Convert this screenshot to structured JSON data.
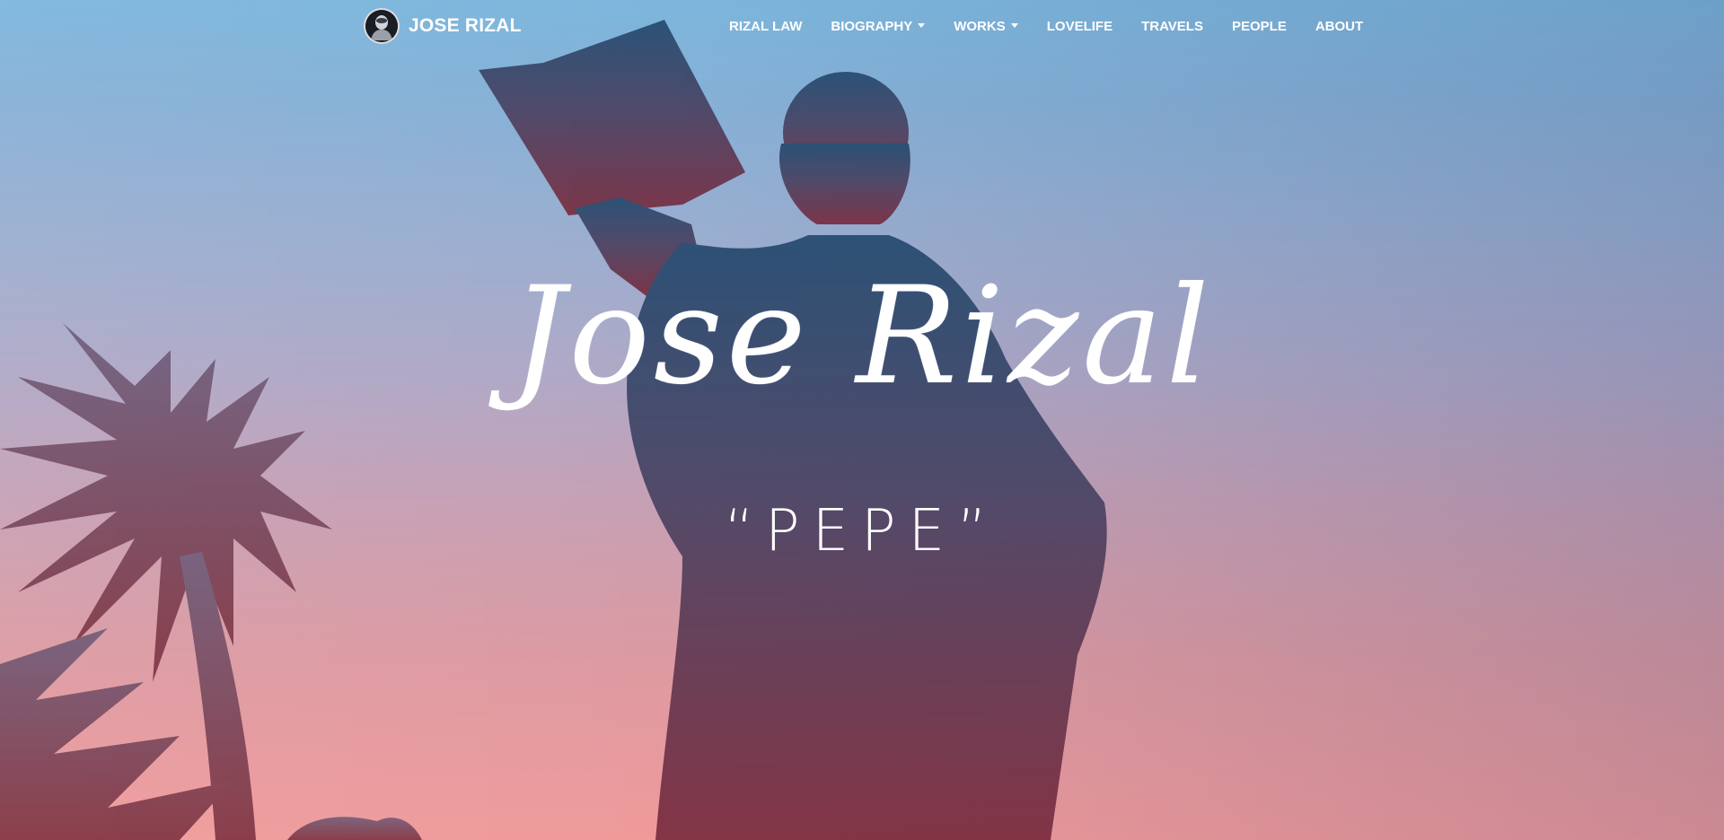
{
  "brand": {
    "text": "JOSE RIZAL",
    "logo_icon": "rizal-portrait-icon"
  },
  "nav": {
    "items": [
      {
        "label": "RIZAL LAW",
        "dropdown": false
      },
      {
        "label": "BIOGRAPHY",
        "dropdown": true
      },
      {
        "label": "WORKS",
        "dropdown": true
      },
      {
        "label": "LOVELIFE",
        "dropdown": false
      },
      {
        "label": "TRAVELS",
        "dropdown": false
      },
      {
        "label": "PEOPLE",
        "dropdown": false
      },
      {
        "label": "ABOUT",
        "dropdown": false
      }
    ]
  },
  "hero": {
    "title": "Jose Rizal",
    "subtitle": "“PEPE”"
  },
  "colors": {
    "sky_top": "#7cb6dc",
    "sky_bottom": "#f09a9a",
    "silhouette": "#3a3a55"
  }
}
